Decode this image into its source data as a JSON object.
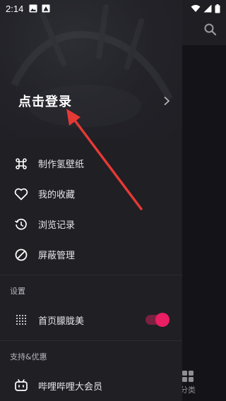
{
  "status_bar": {
    "time": "2:14"
  },
  "background": {
    "bottom_tab_label": "分类"
  },
  "drawer": {
    "login_label": "点击登录",
    "menu": [
      {
        "label": "制作氢壁纸",
        "icon": "command-icon"
      },
      {
        "label": "我的收藏",
        "icon": "heart-icon"
      },
      {
        "label": "浏览记录",
        "icon": "history-icon"
      },
      {
        "label": "屏蔽管理",
        "icon": "block-icon"
      }
    ],
    "settings_section": {
      "title": "设置",
      "item_label": "首页朦胧美",
      "toggle_on": true
    },
    "support_section": {
      "title": "支持&优惠",
      "item_label": "哔哩哔哩大会员"
    }
  },
  "colors": {
    "accent": "#e91e63",
    "annotation": "#e53935",
    "drawer_bg": "#1f1f24"
  }
}
